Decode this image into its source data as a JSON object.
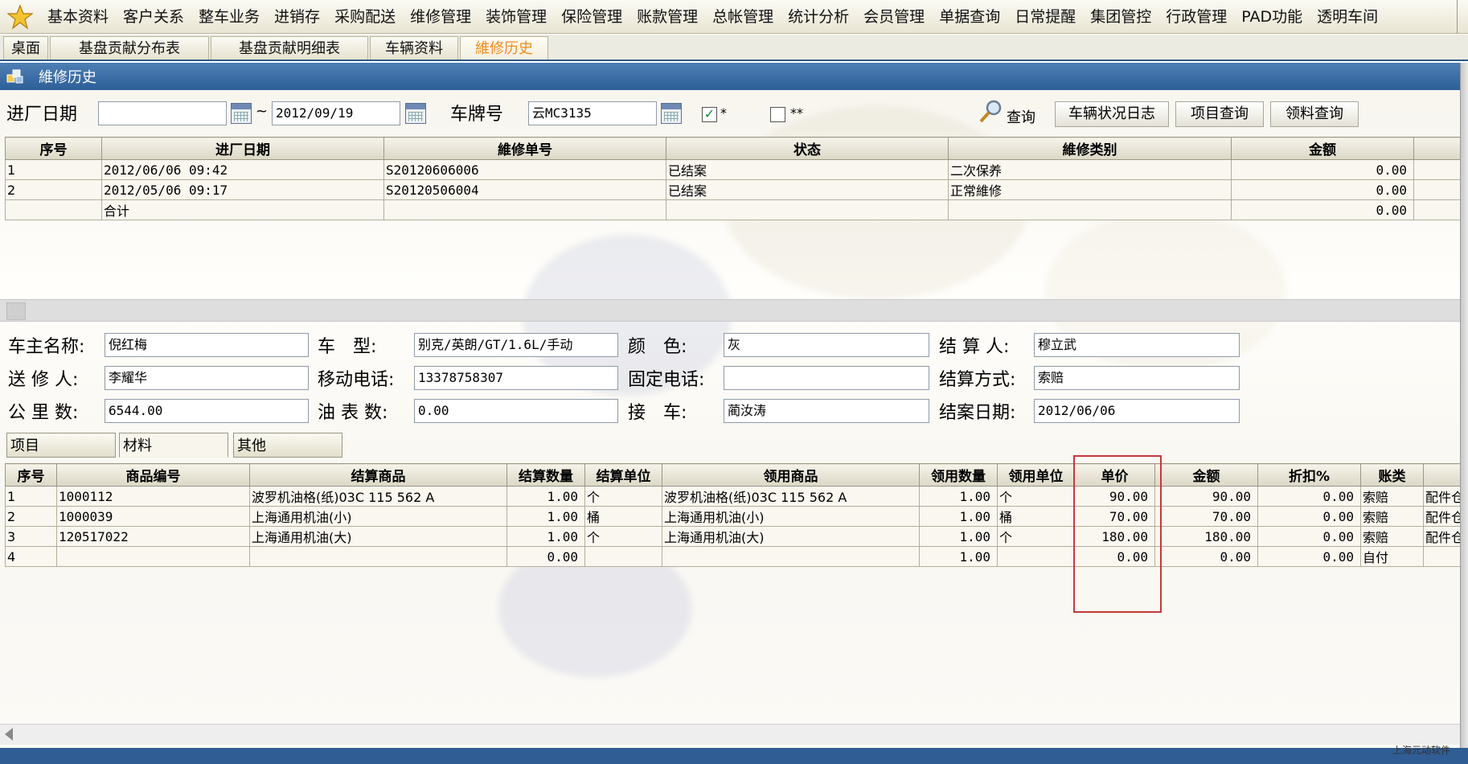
{
  "menu": [
    "基本资料",
    "客户关系",
    "整车业务",
    "进销存",
    "采购配送",
    "维修管理",
    "装饰管理",
    "保险管理",
    "账款管理",
    "总帐管理",
    "统计分析",
    "会员管理",
    "单据查询",
    "日常提醒",
    "集团管控",
    "行政管理",
    "PAD功能",
    "透明车间"
  ],
  "tabs": [
    "桌面",
    "基盘贡献分布表",
    "基盘贡献明细表",
    "车辆资料",
    "維修历史"
  ],
  "active_tab": 4,
  "window_title": "維修历史",
  "filter": {
    "date_label": "进厂日期",
    "date_from": "",
    "tilde": "~",
    "date_to": "2012/09/19",
    "plate_label": "车牌号",
    "plate_value": "云MC3135",
    "check1_label": "*",
    "check1_mark": "✓",
    "check2_label": "**",
    "query_btn": "查询",
    "btn_log": "车辆状况日志",
    "btn_item": "项目查询",
    "btn_material": "领料查询"
  },
  "upper_table": {
    "headers": [
      "序号",
      "进厂日期",
      "維修单号",
      "状态",
      "維修类别",
      "金额"
    ],
    "rows": [
      [
        "1",
        "2012/06/06 09:42",
        "S20120606006",
        "已结案",
        "二次保养",
        "0.00"
      ],
      [
        "2",
        "2012/05/06 09:17",
        "S20120506004",
        "已结案",
        "正常維修",
        "0.00"
      ],
      [
        "",
        "合计",
        "",
        "",
        "",
        "0.00"
      ]
    ]
  },
  "detail": {
    "owner_label": "车主名称:",
    "owner": "倪红梅",
    "model_label": "车　型:",
    "model": "别克/英朗/GT/1.6L/手动",
    "color_label": "颜　色:",
    "color": "灰",
    "settler_label": "结 算 人:",
    "settler": "穆立武",
    "sender_label": "送 修 人:",
    "sender": "李耀华",
    "mobile_label": "移动电话:",
    "mobile": "13378758307",
    "phone_label": "固定电话:",
    "phone": "",
    "settle_method_label": "结算方式:",
    "settle_method": "索赔",
    "mileage_label": "公 里 数:",
    "mileage": "6544.00",
    "fuel_label": "油 表 数:",
    "fuel": "0.00",
    "pickup_label": "接　车:",
    "pickup": "蔺汝涛",
    "close_date_label": "结案日期:",
    "close_date": "2012/06/06"
  },
  "detail_tabs": [
    "项目",
    "材料",
    "其他"
  ],
  "lower_table": {
    "headers": [
      "序号",
      "商品编号",
      "结算商品",
      "结算数量",
      "结算单位",
      "领用商品",
      "领用数量",
      "领用单位",
      "单价",
      "金额",
      "折扣%",
      "账类",
      ""
    ],
    "rows": [
      [
        "1",
        "1000112",
        "波罗机油格(纸)03C 115 562 A",
        "1.00",
        "个",
        "波罗机油格(纸)03C 115 562 A",
        "1.00",
        "个",
        "90.00",
        "90.00",
        "0.00",
        "索赔",
        "配件仓"
      ],
      [
        "2",
        "1000039",
        "上海通用机油(小)",
        "1.00",
        "桶",
        "上海通用机油(小)",
        "1.00",
        "桶",
        "70.00",
        "70.00",
        "0.00",
        "索赔",
        "配件仓"
      ],
      [
        "3",
        "120517022",
        "上海通用机油(大)",
        "1.00",
        "个",
        "上海通用机油(大)",
        "1.00",
        "个",
        "180.00",
        "180.00",
        "0.00",
        "索赔",
        "配件仓"
      ],
      [
        "4",
        "",
        "",
        "0.00",
        "",
        "",
        "1.00",
        "",
        "0.00",
        "0.00",
        "0.00",
        "自付",
        ""
      ]
    ]
  },
  "watermark": "上海元动软件"
}
